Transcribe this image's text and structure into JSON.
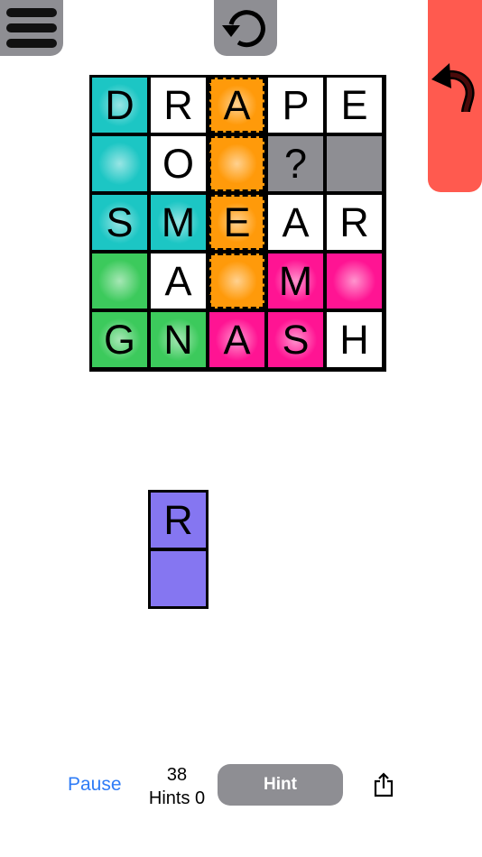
{
  "colors": {
    "teal": "#1cc6c4",
    "white": "#ffffff",
    "orange": "#ff9a0a",
    "gray": "#8e8e93",
    "green": "#3cca5c",
    "pink": "#ff1493",
    "purple": "#8576f1",
    "undo_red": "#ff5a4f",
    "link_blue": "#2f7cf6"
  },
  "board": {
    "rows": [
      [
        {
          "letter": "D",
          "color": "teal"
        },
        {
          "letter": "R",
          "color": "white"
        },
        {
          "letter": "A",
          "color": "orange"
        },
        {
          "letter": "P",
          "color": "white"
        },
        {
          "letter": "E",
          "color": "white"
        }
      ],
      [
        {
          "letter": "",
          "color": "teal"
        },
        {
          "letter": "O",
          "color": "white"
        },
        {
          "letter": "",
          "color": "orange"
        },
        {
          "letter": "?",
          "color": "gray"
        },
        {
          "letter": "",
          "color": "gray"
        }
      ],
      [
        {
          "letter": "S",
          "color": "teal"
        },
        {
          "letter": "M",
          "color": "teal"
        },
        {
          "letter": "E",
          "color": "orange"
        },
        {
          "letter": "A",
          "color": "white"
        },
        {
          "letter": "R",
          "color": "white"
        }
      ],
      [
        {
          "letter": "",
          "color": "green"
        },
        {
          "letter": "A",
          "color": "white"
        },
        {
          "letter": "",
          "color": "orange"
        },
        {
          "letter": "M",
          "color": "pink"
        },
        {
          "letter": "",
          "color": "pink"
        }
      ],
      [
        {
          "letter": "G",
          "color": "green"
        },
        {
          "letter": "N",
          "color": "green"
        },
        {
          "letter": "A",
          "color": "pink"
        },
        {
          "letter": "S",
          "color": "pink"
        },
        {
          "letter": "H",
          "color": "white"
        }
      ]
    ]
  },
  "piece": {
    "cells": [
      {
        "letter": "R",
        "color": "purple"
      },
      {
        "letter": "",
        "color": "purple"
      }
    ]
  },
  "icons": {
    "menu": "hamburger-icon",
    "reset": "reset-icon",
    "undo": "undo-arrow-icon",
    "share": "share-icon"
  },
  "footer": {
    "pause_label": "Pause",
    "score": "38",
    "hints_text": "Hints 0",
    "hint_label": "Hint"
  }
}
